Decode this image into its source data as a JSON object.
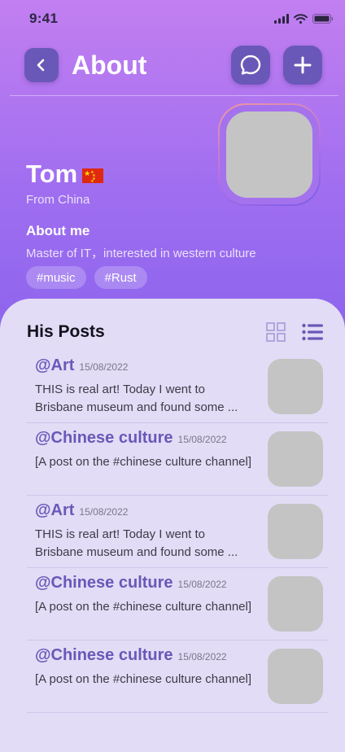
{
  "status_bar": {
    "time": "9:41"
  },
  "header": {
    "title": "About"
  },
  "profile": {
    "name": "Tom",
    "from": "From China",
    "about_title": "About me",
    "about_text": "Master of IT，interested in western culture",
    "tags": [
      "#music",
      "#Rust"
    ]
  },
  "posts": {
    "title": "His Posts",
    "items": [
      {
        "channel": "@Art",
        "date": "15/08/2022",
        "excerpt": "THIS is real art! Today I went to Brisbane museum and found some ..."
      },
      {
        "channel": "@Chinese culture",
        "date": "15/08/2022",
        "excerpt": "[A post on the #chinese culture channel]"
      },
      {
        "channel": "@Art",
        "date": "15/08/2022",
        "excerpt": "THIS is real art! Today I went to Brisbane museum and found some ..."
      },
      {
        "channel": "@Chinese culture",
        "date": "15/08/2022",
        "excerpt": "[A post on the #chinese culture channel]"
      },
      {
        "channel": "@Chinese culture",
        "date": "15/08/2022",
        "excerpt": "[A post on the #chinese culture channel]"
      }
    ]
  },
  "colors": {
    "accent": "#6a58b8",
    "panel": "#e3dcf6",
    "gradient_top": "#c27ff0",
    "gradient_bottom": "#8f66ee"
  },
  "icons": [
    "signal-icon",
    "wifi-icon",
    "battery-icon",
    "back-arrow-icon",
    "chat-bubble-icon",
    "plus-icon",
    "grid-view-icon",
    "list-view-icon",
    "china-flag-icon"
  ]
}
